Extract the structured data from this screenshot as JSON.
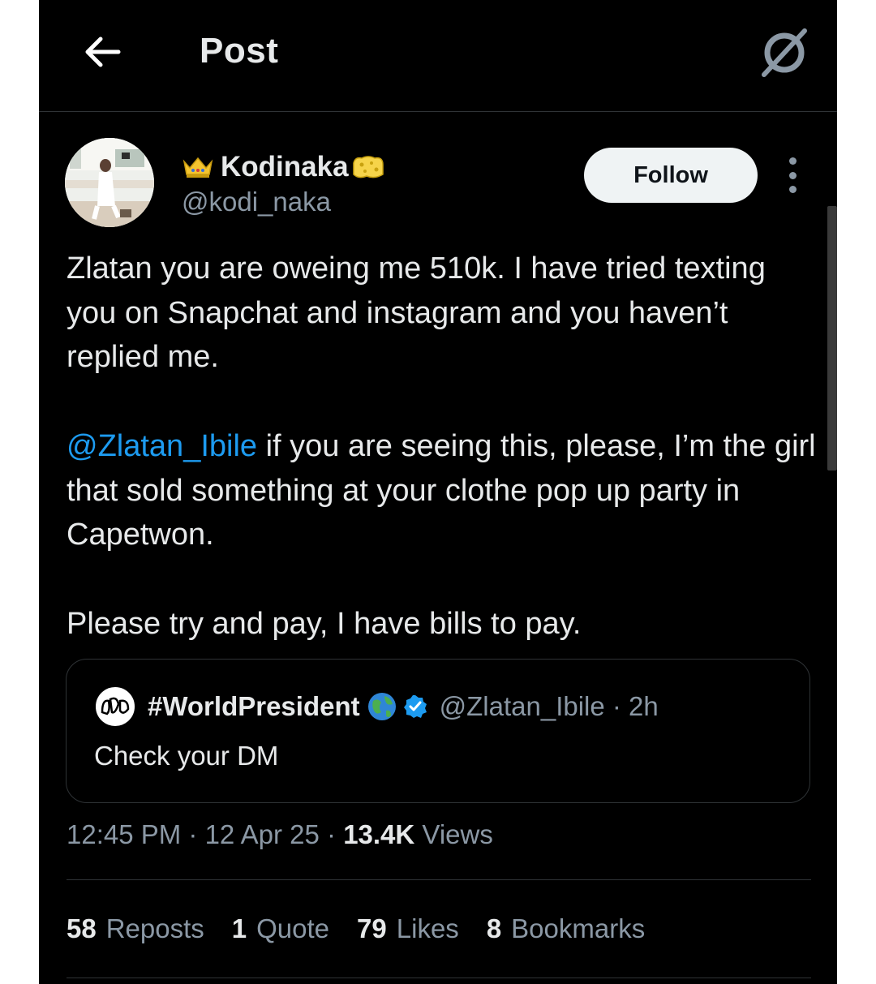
{
  "header": {
    "title": "Post",
    "back_icon": "arrow-left-icon",
    "grok_icon": "grok-icon"
  },
  "author": {
    "display_name": "Kodinaka",
    "name_prefix_emoji": "crown-icon",
    "name_suffix_emoji": "sponge-icon",
    "handle": "@kodi_naka",
    "follow_label": "Follow"
  },
  "tweet": {
    "paragraph1": "Zlatan you are oweing me 510k. I have tried texting you on Snapchat and instagram and you haven’t replied me.",
    "mention": "@Zlatan_Ibile",
    "paragraph2_rest": " if you are seeing this, please, I’m the girl that sold something at your clothe pop up party in Capetwon.",
    "paragraph3": "Please try and pay, I have bills to pay."
  },
  "quote": {
    "display_name": "#WorldPresident",
    "handle_time": "@Zlatan_Ibile · 2h",
    "text": "Check your DM"
  },
  "meta": {
    "time": "12:45 PM",
    "sep1": " · ",
    "date": "12 Apr 25",
    "sep2": " · ",
    "views_count": "13.4K",
    "views_label": " Views"
  },
  "stats": [
    {
      "count": "58",
      "label": "Reposts"
    },
    {
      "count": "1",
      "label": "Quote"
    },
    {
      "count": "79",
      "label": "Likes"
    },
    {
      "count": "8",
      "label": "Bookmarks"
    }
  ],
  "colors": {
    "background": "#000000",
    "text": "#e7e9ea",
    "secondary": "#8b98a5",
    "link": "#1d9bf0",
    "border": "#2f3336"
  }
}
